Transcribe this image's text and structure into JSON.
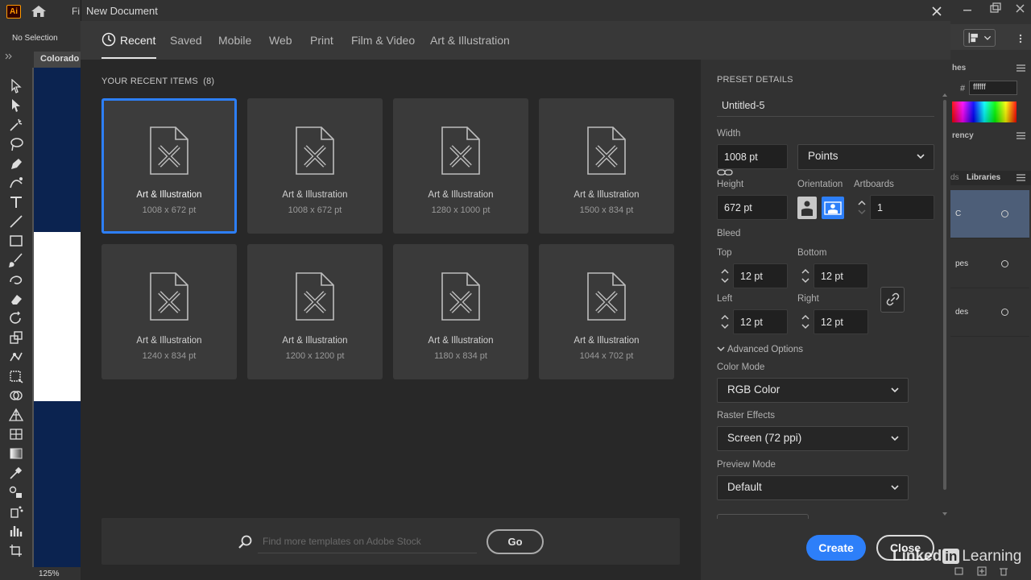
{
  "app": {
    "file_menu_label": "Fi",
    "no_selection": "No Selection",
    "doc_tab": "Colorado",
    "zoom": "125%"
  },
  "right_panel": {
    "swatches_title": "hes",
    "hex_value": "ffffff",
    "transparency_title": "rency",
    "libraries_tab_a": "ds",
    "libraries_tab_b": "Libraries",
    "rows": [
      {
        "label": "C"
      },
      {
        "label": "pes"
      },
      {
        "label": "des"
      }
    ]
  },
  "dialog": {
    "title": "New Document",
    "tabs": [
      "Recent",
      "Saved",
      "Mobile",
      "Web",
      "Print",
      "Film & Video",
      "Art & Illustration"
    ],
    "recent_heading": "YOUR RECENT ITEMS",
    "recent_count": "(8)",
    "items": [
      {
        "name": "Art & Illustration",
        "size": "1008 x 672 pt"
      },
      {
        "name": "Art & Illustration",
        "size": "1008 x 672 pt"
      },
      {
        "name": "Art & Illustration",
        "size": "1280 x 1000 pt"
      },
      {
        "name": "Art & Illustration",
        "size": "1500 x 834 pt"
      },
      {
        "name": "Art & Illustration",
        "size": "1240 x 834 pt"
      },
      {
        "name": "Art & Illustration",
        "size": "1200 x 1200 pt"
      },
      {
        "name": "Art & Illustration",
        "size": "1180 x 834 pt"
      },
      {
        "name": "Art & Illustration",
        "size": "1044 x 702 pt"
      }
    ],
    "stock_placeholder": "Find more templates on Adobe Stock",
    "go_label": "Go"
  },
  "preset": {
    "heading": "PRESET DETAILS",
    "name": "Untitled-5",
    "width_label": "Width",
    "width_value": "1008 pt",
    "units": "Points",
    "height_label": "Height",
    "height_value": "672 pt",
    "orientation_label": "Orientation",
    "artboards_label": "Artboards",
    "artboards_value": "1",
    "bleed_label": "Bleed",
    "top_label": "Top",
    "top_value": "12 pt",
    "bottom_label": "Bottom",
    "bottom_value": "12 pt",
    "left_label": "Left",
    "left_value": "12 pt",
    "right_label": "Right",
    "right_value": "12 pt",
    "advanced_label": "Advanced Options",
    "color_mode_label": "Color Mode",
    "color_mode_value": "RGB Color",
    "raster_label": "Raster Effects",
    "raster_value": "Screen (72 ppi)",
    "preview_label": "Preview Mode",
    "preview_value": "Default",
    "create_label": "Create",
    "close_label": "Close"
  },
  "watermark": {
    "linked": "Linked",
    "in": "in",
    "learning": "Learning"
  },
  "colors": {
    "accent": "#2d7ff9",
    "dialog_bg": "#282828",
    "panel_bg": "#323232"
  }
}
